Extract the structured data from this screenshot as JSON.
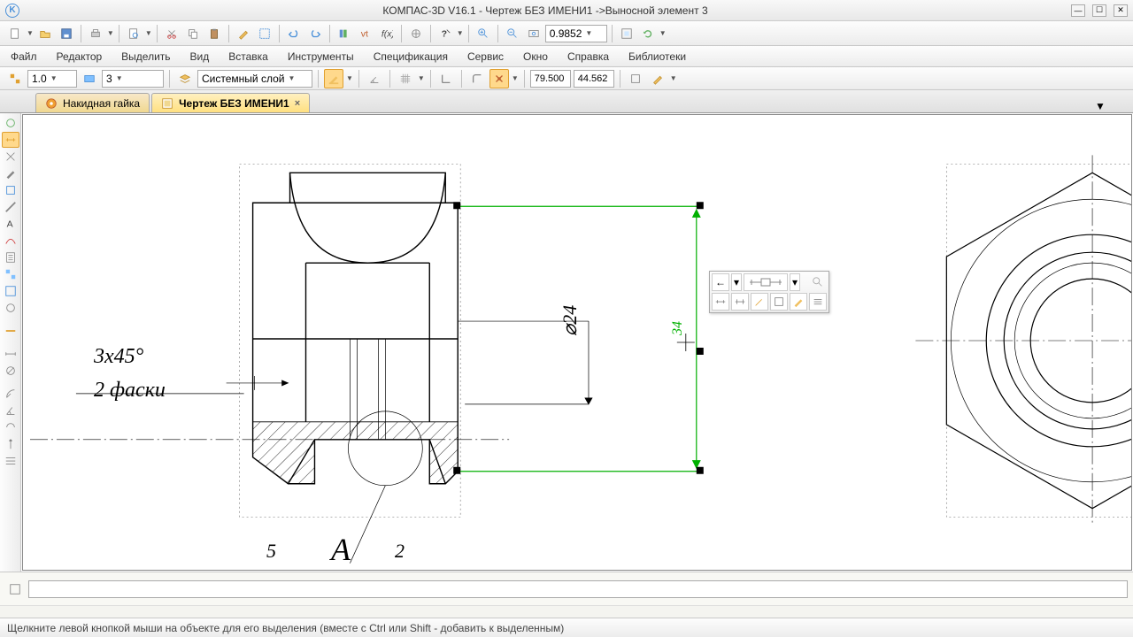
{
  "title": "КОМПАС-3D V16.1 - Чертеж БЕЗ ИМЕНИ1 ->Выносной элемент 3",
  "toolbar1": {
    "zoom_value": "0.9852"
  },
  "menu": [
    "Файл",
    "Редактор",
    "Выделить",
    "Вид",
    "Вставка",
    "Инструменты",
    "Спецификация",
    "Сервис",
    "Окно",
    "Справка",
    "Библиотеки"
  ],
  "propbar": {
    "num1": "1.0",
    "num2": "3",
    "layer_label": "Системный слой",
    "coord_x": "79.500",
    "coord_y": "44.562"
  },
  "tabs": [
    {
      "label": "Накидная гайка",
      "active": false
    },
    {
      "label": "Чертеж БЕЗ ИМЕНИ1",
      "active": true
    }
  ],
  "drawing": {
    "chamfer": "3x45°",
    "chamfer_note": "2 фаски",
    "dia": "⌀24",
    "cursor_dim": "34",
    "label_A": "А",
    "num_5": "5",
    "num_2": "2"
  },
  "status": "Щелкните левой кнопкой мыши на объекте для его выделения (вместе с Ctrl или Shift - добавить к выделенным)"
}
